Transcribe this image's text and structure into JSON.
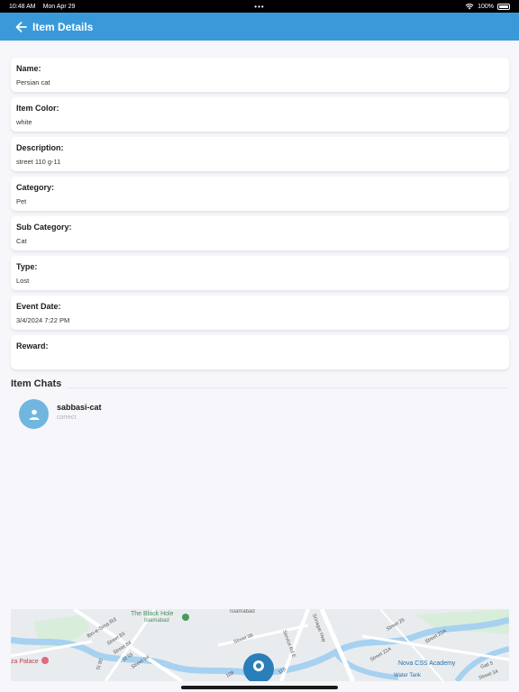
{
  "status_bar": {
    "time": "10:48 AM",
    "date": "Mon Apr 29",
    "dots": "•••",
    "battery": "100%"
  },
  "app_bar": {
    "title": "Item Details"
  },
  "fields": [
    {
      "label": "Name:",
      "value": "Persian cat"
    },
    {
      "label": "Item Color:",
      "value": "white"
    },
    {
      "label": "Description:",
      "value": "street 110 g-11"
    },
    {
      "label": "Category:",
      "value": "Pet"
    },
    {
      "label": "Sub Category:",
      "value": "Cat"
    },
    {
      "label": "Type:",
      "value": "Lost"
    },
    {
      "label": "Event Date:",
      "value": "3/4/2024 7:22 PM"
    },
    {
      "label": "Reward:",
      "value": ""
    }
  ],
  "chats": {
    "heading": "Item Chats",
    "items": [
      {
        "name": "sabbasi-cat",
        "last_message": "correct"
      }
    ]
  },
  "map": {
    "labels": {
      "black_hole": "The Black Hole",
      "islamabad_small": "Islamabad",
      "islamabad_top": "Islamabad",
      "ibn_e_sina": "Ibn-e-Sina Rd",
      "street83": "Street 83",
      "street84": "Street 84",
      "street93": "St 93",
      "street94": "Street 94",
      "st90": "St 90",
      "street38": "Street 38",
      "service_rd_e": "Service Rd E",
      "srinagar_hwy": "Srinagar Hwy",
      "street_26": "Street 26",
      "street_22a": "Street 22A",
      "street_22a_2": "Street 22A",
      "nova_css": "Nova CSS Academy",
      "water_tank": "Water Tank",
      "gali5": "Gali 5",
      "street34": "Street 34",
      "pizza_palace": "za Palace",
      "street109": "109",
      "street110": "110"
    },
    "colors": {
      "land": "#e9ecef",
      "water": "#a7d1f0",
      "park": "#d8eedb",
      "road": "#ffffff",
      "pin": "#2a7fb8"
    }
  },
  "colors": {
    "app_bar": "#3a9ad9",
    "avatar": "#71b6de",
    "background": "#f6f6fb"
  }
}
